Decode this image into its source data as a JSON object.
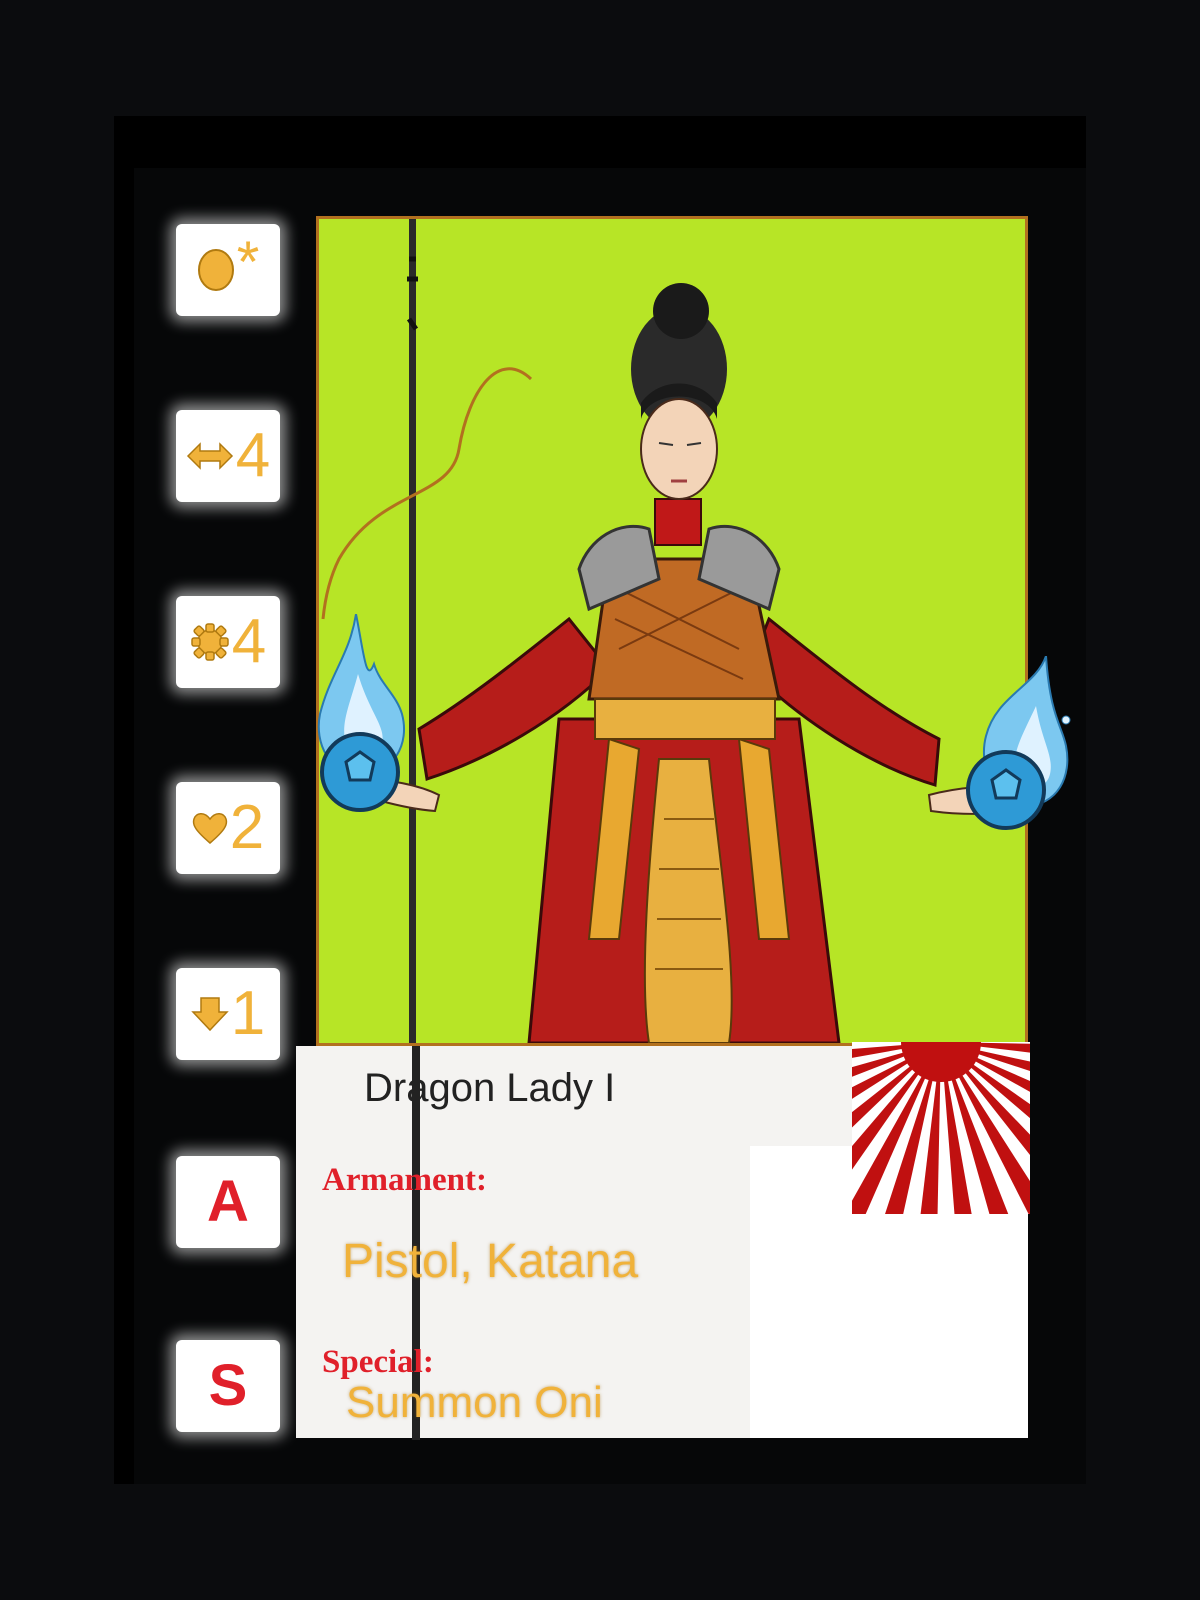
{
  "card": {
    "name": "Dragon Lady I",
    "armament_label": "Armament:",
    "armament": "Pistol, Katana",
    "special_label": "Special:",
    "special": "Summon Oni"
  },
  "stats": [
    {
      "icon": "coin-icon",
      "value": "*"
    },
    {
      "icon": "move-arrows-icon",
      "value": "4"
    },
    {
      "icon": "gear-icon",
      "value": "4"
    },
    {
      "icon": "heart-icon",
      "value": "2"
    },
    {
      "icon": "down-arrow-icon",
      "value": "1"
    },
    {
      "icon": "",
      "value": "A"
    },
    {
      "icon": "",
      "value": "S"
    }
  ],
  "colors": {
    "background": "#0b0c0e",
    "art_bg": "#b7e526",
    "stat_gold": "#f0b23a",
    "label_red": "#e0202a",
    "robe_red": "#b61d1a",
    "flame_blue": "#3aa6e0"
  }
}
